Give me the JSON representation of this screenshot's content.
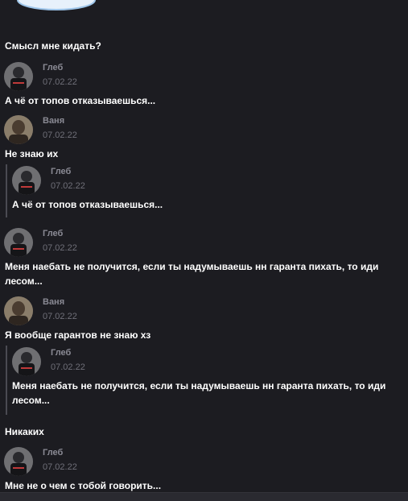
{
  "messages": [
    {
      "text": "Смысл мне кидать?"
    },
    {
      "author": "Глеб",
      "date": "07.02.22",
      "text": "А чё от топов отказываешься..."
    },
    {
      "author": "Ваня",
      "date": "07.02.22",
      "text": "Не знаю их",
      "quote": {
        "author": "Глеб",
        "date": "07.02.22",
        "text": "А чё от топов отказываешься..."
      }
    },
    {
      "author": "Глеб",
      "date": "07.02.22",
      "text": "Меня наебать не получится, если ты надумываешь нн гаранта пихать, то иди лесом..."
    },
    {
      "author": "Ваня",
      "date": "07.02.22",
      "text": "Я вообще гарантов не знаю хз",
      "quote": {
        "author": "Глеб",
        "date": "07.02.22",
        "text": "Меня наебать не получится, если ты надумываешь нн гаранта пихать, то иди лесом..."
      }
    },
    {
      "text": "Никаких"
    },
    {
      "author": "Глеб",
      "date": "07.02.22",
      "text": "Мне не о чем с тобой говорить..."
    }
  ]
}
